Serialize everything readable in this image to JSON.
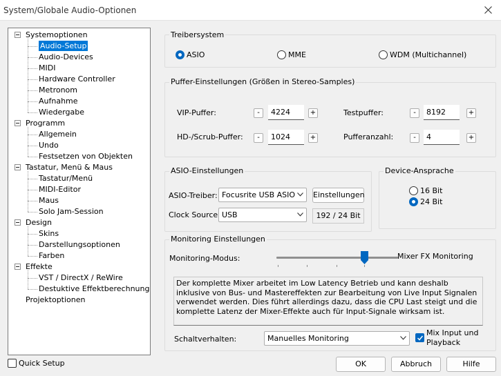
{
  "window": {
    "title": "System/Globale Audio-Optionen",
    "close_glyph": "✕"
  },
  "tree": {
    "items": [
      {
        "label": "Systemoptionen",
        "level": 0,
        "expander": true
      },
      {
        "label": "Audio-Setup",
        "level": 1,
        "selected": true
      },
      {
        "label": "Audio-Devices",
        "level": 1
      },
      {
        "label": "MIDI",
        "level": 1
      },
      {
        "label": "Hardware Controller",
        "level": 1
      },
      {
        "label": "Metronom",
        "level": 1
      },
      {
        "label": "Aufnahme",
        "level": 1
      },
      {
        "label": "Wiedergabe",
        "level": 1
      },
      {
        "label": "Programm",
        "level": 0,
        "expander": true
      },
      {
        "label": "Allgemein",
        "level": 1
      },
      {
        "label": "Undo",
        "level": 1
      },
      {
        "label": "Festsetzen von Objekten",
        "level": 1
      },
      {
        "label": "Tastatur, Menü & Maus",
        "level": 0,
        "expander": true
      },
      {
        "label": "Tastatur/Menü",
        "level": 1
      },
      {
        "label": "MIDI-Editor",
        "level": 1
      },
      {
        "label": "Maus",
        "level": 1
      },
      {
        "label": "Solo Jam-Session",
        "level": 1
      },
      {
        "label": "Design",
        "level": 0,
        "expander": true
      },
      {
        "label": "Skins",
        "level": 1
      },
      {
        "label": "Darstellungsoptionen",
        "level": 1
      },
      {
        "label": "Farben",
        "level": 1
      },
      {
        "label": "Effekte",
        "level": 0,
        "expander": true
      },
      {
        "label": "VST / DirectX / ReWire",
        "level": 1
      },
      {
        "label": "Destuktive Effektberechnung",
        "level": 1
      },
      {
        "label": "Projektoptionen",
        "level": 0,
        "expander": false
      }
    ]
  },
  "quick_setup": {
    "label": "Quick Setup",
    "checked": false
  },
  "treiber": {
    "title": "Treibersystem",
    "options": [
      {
        "label": "ASIO",
        "selected": true
      },
      {
        "label": "MME",
        "selected": false
      },
      {
        "label": "WDM (Multichannel)",
        "selected": false
      }
    ]
  },
  "puffer": {
    "title": "Puffer-Einstellungen (Größen in Stereo-Samples)",
    "vip_label": "VIP-Puffer:",
    "vip_value": "4224",
    "hd_label": "HD-/Scrub-Puffer:",
    "hd_value": "1024",
    "test_label": "Testpuffer:",
    "test_value": "8192",
    "anzahl_label": "Pufferanzahl:",
    "anzahl_value": "4",
    "minus": "-",
    "plus": "+"
  },
  "asio": {
    "title": "ASIO-Einstellungen",
    "treiber_label": "ASIO-Treiber:",
    "treiber_value": "Focusrite USB ASIO",
    "einstellungen_button": "Einstellungen",
    "clock_label": "Clock Source:",
    "clock_value": "USB",
    "format_readout": "192 / 24 Bit"
  },
  "device": {
    "title": "Device-Ansprache",
    "options": [
      {
        "label": "16 Bit",
        "selected": false
      },
      {
        "label": "24 Bit",
        "selected": true
      }
    ]
  },
  "monitoring": {
    "title": "Monitoring Einstellungen",
    "modus_label": "Monitoring-Modus:",
    "modus_value_label": "Mixer FX Monitoring",
    "slider_position_fraction": 1.0,
    "description": "Der komplette Mixer arbeitet im Low Latency Betrieb und kann deshalb inklusive von Bus- und Mastereffekten zur Bearbeitung von Live Input Signalen verwendet werden. Dies führt allerdings dazu, dass die CPU Last steigt und die komplette Latenz der Mixer-Effekte auch für Input-Signale wirksam ist.",
    "schalt_label": "Schaltverhalten:",
    "schalt_value": "Manuelles Monitoring",
    "mix_input_label": "Mix Input und Playback",
    "mix_input_checked": true
  },
  "buttons": {
    "ok": "OK",
    "abbruch": "Abbruch",
    "hilfe": "Hilfe"
  },
  "colors": {
    "accent": "#0078d7",
    "check": "#0067c0",
    "window_bg": "#f0f0f0"
  }
}
